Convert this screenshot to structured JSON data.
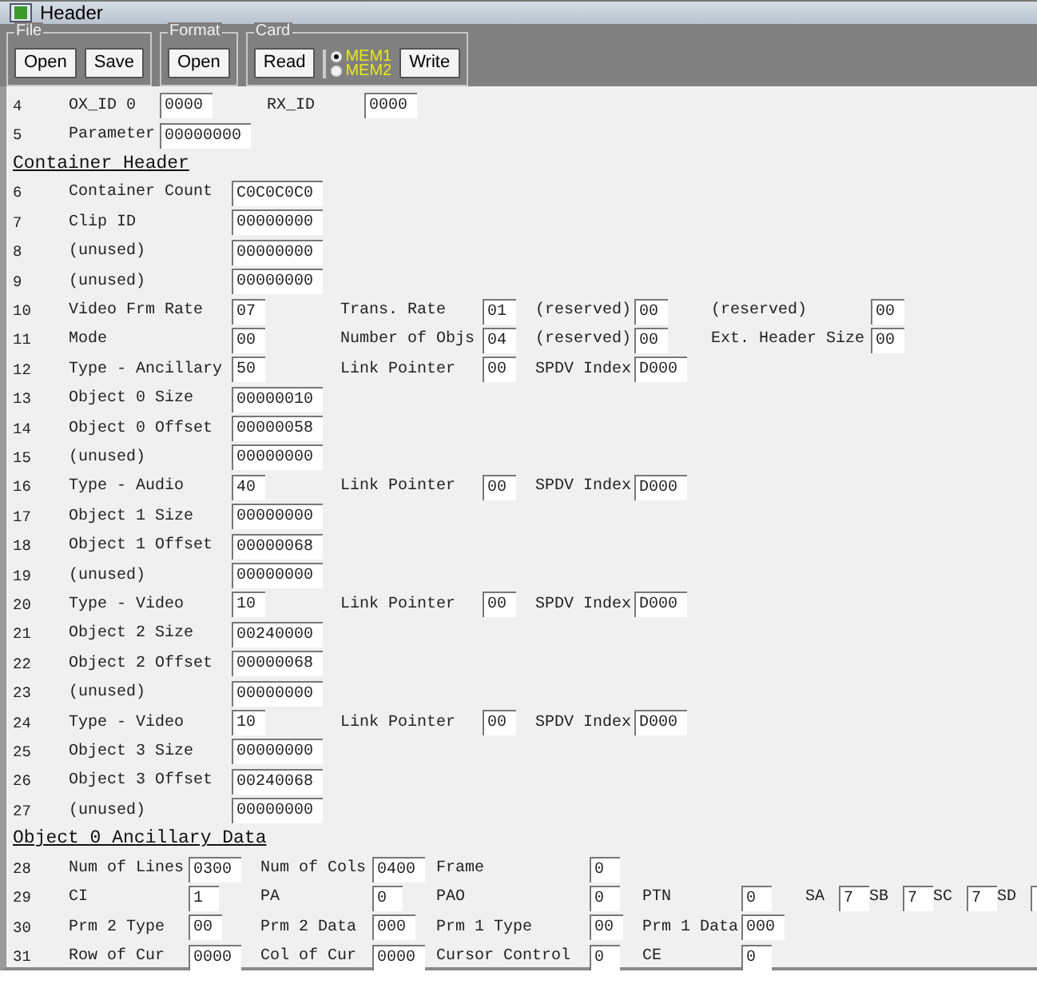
{
  "window": {
    "title": "Header"
  },
  "toolbar": [
    {
      "title": "File",
      "items": [
        {
          "kind": "button",
          "label": "Open"
        },
        {
          "kind": "button",
          "label": "Save"
        }
      ]
    },
    {
      "title": "Format",
      "items": [
        {
          "kind": "button",
          "label": "Open"
        }
      ]
    },
    {
      "title": "Card",
      "items": [
        {
          "kind": "button",
          "label": "Read"
        },
        {
          "kind": "radios",
          "options": [
            {
              "label": "MEM1",
              "selected": true
            },
            {
              "label": "MEM2",
              "selected": false
            }
          ]
        },
        {
          "kind": "button",
          "label": "Write"
        }
      ]
    }
  ],
  "sections": [
    {
      "kind": "top",
      "rows": [
        {
          "num": "4",
          "cells": [
            {
              "label": "OX_ID 0",
              "value": "0000"
            },
            {
              "label": "RX_ID",
              "value": "0000"
            }
          ]
        },
        {
          "num": "5",
          "cells": [
            {
              "label": "Parameter",
              "value": "00000000"
            }
          ]
        }
      ]
    },
    {
      "kind": "container",
      "heading": "Container Header",
      "rows": [
        {
          "num": "6",
          "cells": [
            {
              "label": "Container Count",
              "value": "C0C0C0C0"
            }
          ]
        },
        {
          "num": "7",
          "cells": [
            {
              "label": "Clip ID",
              "value": "00000000"
            }
          ]
        },
        {
          "num": "8",
          "cells": [
            {
              "label": "(unused)",
              "value": "00000000"
            }
          ]
        },
        {
          "num": "9",
          "cells": [
            {
              "label": "(unused)",
              "value": "00000000"
            }
          ]
        },
        {
          "num": "10",
          "cells": [
            {
              "label": "Video Frm Rate",
              "value": "07"
            },
            {
              "label": "Trans. Rate",
              "value": "01"
            },
            {
              "label": "(reserved)",
              "value": "00"
            },
            {
              "label": "(reserved)",
              "value": "00"
            }
          ]
        },
        {
          "num": "11",
          "cells": [
            {
              "label": "Mode",
              "value": "00"
            },
            {
              "label": "Number of Objs",
              "value": "04"
            },
            {
              "label": "(reserved)",
              "value": "00"
            },
            {
              "label": "Ext. Header Size",
              "value": "00"
            }
          ]
        },
        {
          "num": "12",
          "cells": [
            {
              "label": "Type - Ancillary",
              "value": "50"
            },
            {
              "label": "Link Pointer",
              "value": "00"
            },
            {
              "label": "SPDV Index",
              "value": "D000"
            }
          ]
        },
        {
          "num": "13",
          "cells": [
            {
              "label": "Object 0 Size",
              "value": "00000010"
            }
          ]
        },
        {
          "num": "14",
          "cells": [
            {
              "label": "Object 0 Offset",
              "value": "00000058"
            }
          ]
        },
        {
          "num": "15",
          "cells": [
            {
              "label": "(unused)",
              "value": "00000000"
            }
          ]
        },
        {
          "num": "16",
          "cells": [
            {
              "label": "Type - Audio",
              "value": "40"
            },
            {
              "label": "Link Pointer",
              "value": "00"
            },
            {
              "label": "SPDV Index",
              "value": "D000"
            }
          ]
        },
        {
          "num": "17",
          "cells": [
            {
              "label": "Object 1 Size",
              "value": "00000000"
            }
          ]
        },
        {
          "num": "18",
          "cells": [
            {
              "label": "Object 1 Offset",
              "value": "00000068"
            }
          ]
        },
        {
          "num": "19",
          "cells": [
            {
              "label": "(unused)",
              "value": "00000000"
            }
          ]
        },
        {
          "num": "20",
          "cells": [
            {
              "label": "Type - Video",
              "value": "10"
            },
            {
              "label": "Link Pointer",
              "value": "00"
            },
            {
              "label": "SPDV Index",
              "value": "D000"
            }
          ]
        },
        {
          "num": "21",
          "cells": [
            {
              "label": "Object 2 Size",
              "value": "00240000"
            }
          ]
        },
        {
          "num": "22",
          "cells": [
            {
              "label": "Object 2 Offset",
              "value": "00000068"
            }
          ]
        },
        {
          "num": "23",
          "cells": [
            {
              "label": "(unused)",
              "value": "00000000"
            }
          ]
        },
        {
          "num": "24",
          "cells": [
            {
              "label": "Type - Video",
              "value": "10"
            },
            {
              "label": "Link Pointer",
              "value": "00"
            },
            {
              "label": "SPDV Index",
              "value": "D000"
            }
          ]
        },
        {
          "num": "25",
          "cells": [
            {
              "label": "Object 3 Size",
              "value": "00000000"
            }
          ]
        },
        {
          "num": "26",
          "cells": [
            {
              "label": "Object 3 Offset",
              "value": "00240068"
            }
          ]
        },
        {
          "num": "27",
          "cells": [
            {
              "label": "(unused)",
              "value": "00000000"
            }
          ]
        }
      ]
    },
    {
      "kind": "ancillary",
      "heading": "Object 0 Ancillary Data",
      "rows": [
        {
          "num": "28",
          "cells": [
            {
              "label": "Num of Lines",
              "value": "0300"
            },
            {
              "label": "Num of Cols",
              "value": "0400"
            },
            {
              "label": "Frame",
              "value": "0"
            }
          ]
        },
        {
          "num": "29",
          "cells": [
            {
              "label": "CI",
              "value": "1"
            },
            {
              "label": "PA",
              "value": "0"
            },
            {
              "label": "PAO",
              "value": "0"
            },
            {
              "label": "PTN",
              "value": "0"
            },
            {
              "label": "SA",
              "value": "7"
            },
            {
              "label": "SB",
              "value": "7"
            },
            {
              "label": "SC",
              "value": "7"
            },
            {
              "label": "SD"
            }
          ]
        },
        {
          "num": "30",
          "cells": [
            {
              "label": "Prm 2 Type",
              "value": "00"
            },
            {
              "label": "Prm 2 Data",
              "value": "000"
            },
            {
              "label": "Prm 1 Type",
              "value": "00"
            },
            {
              "label": "Prm 1 Data",
              "value": "000"
            }
          ]
        },
        {
          "num": "31",
          "cells": [
            {
              "label": "Row of Cur",
              "value": "0000"
            },
            {
              "label": "Col of Cur",
              "value": "0000"
            },
            {
              "label": "Cursor Control",
              "value": "0"
            },
            {
              "label": "CE",
              "value": "0"
            }
          ]
        }
      ]
    }
  ]
}
